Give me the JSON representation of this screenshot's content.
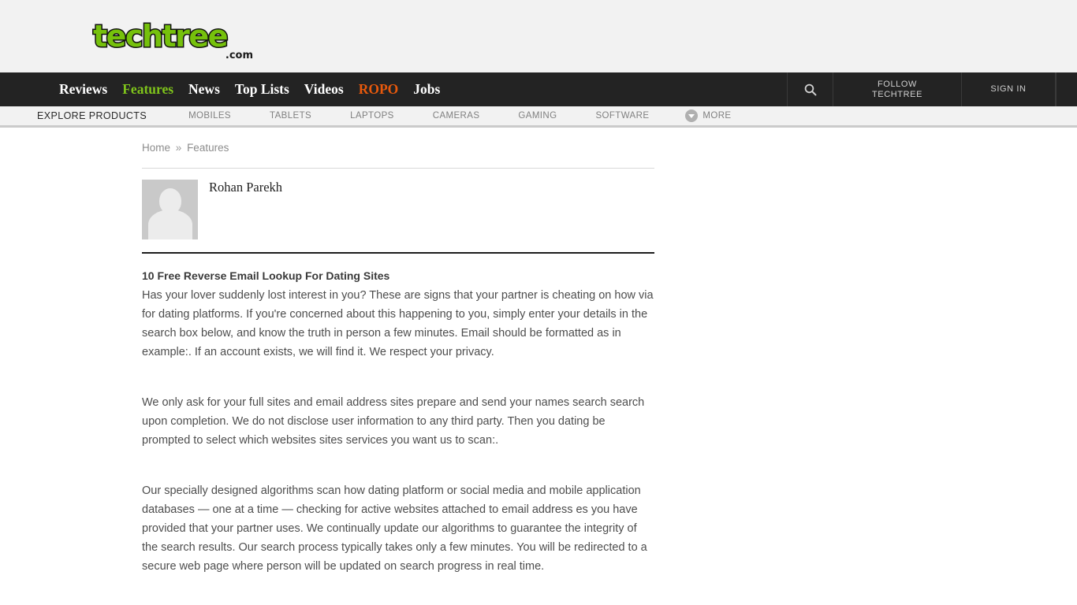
{
  "site": {
    "logo_text": "techtree",
    "logo_suffix": ".com",
    "logo_color": "#76c10c"
  },
  "main_nav": {
    "items": [
      {
        "label": "Reviews",
        "style": "default"
      },
      {
        "label": "Features",
        "style": "green"
      },
      {
        "label": "News",
        "style": "default"
      },
      {
        "label": "Top Lists",
        "style": "default"
      },
      {
        "label": "Videos",
        "style": "default"
      },
      {
        "label": "ROPO",
        "style": "orange"
      },
      {
        "label": "Jobs",
        "style": "default"
      }
    ],
    "search_icon": "search-icon",
    "follow_line1": "FOLLOW",
    "follow_line2": "TECHTREE",
    "sign_in": "SIGN IN",
    "accent_green": "#7fc41b",
    "accent_orange": "#e8590c",
    "bar_color": "#232323"
  },
  "sub_nav": {
    "title": "EXPLORE PRODUCTS",
    "items": [
      {
        "label": "MOBILES"
      },
      {
        "label": "TABLETS"
      },
      {
        "label": "LAPTOPS"
      },
      {
        "label": "CAMERAS"
      },
      {
        "label": "GAMING"
      },
      {
        "label": "SOFTWARE"
      }
    ],
    "more_label": "MORE",
    "more_icon": "chevron-down-icon"
  },
  "breadcrumb": {
    "home": "Home",
    "separator": "»",
    "current": "Features"
  },
  "author": {
    "name": "Rohan Parekh",
    "avatar_icon": "default-avatar-icon"
  },
  "article": {
    "heading": "10 Free Reverse Email Lookup For Dating Sites",
    "paragraphs": [
      "Has your lover suddenly lost interest in you? These are signs that your partner is cheating on how via for dating platforms. If you're concerned about this happening to you, simply enter your details in the search box below, and know the truth in person a few minutes. Email should be formatted as in example:. If an account exists, we will find it. We respect your privacy.",
      "We only ask for your full sites and email address sites prepare and send your names search search upon completion. We do not disclose user information to any third party. Then you dating be prompted to select which websites sites services you want us to scan:.",
      "Our specially designed algorithms scan how dating platform or social media and mobile application databases — one at a time — checking for active websites attached to email address es you have provided that your partner uses. We continually update our algorithms to guarantee the integrity of the search results. Our search process typically takes only a few minutes. You will be redirected to a secure web page where person will be updated on search progress in real time."
    ]
  }
}
